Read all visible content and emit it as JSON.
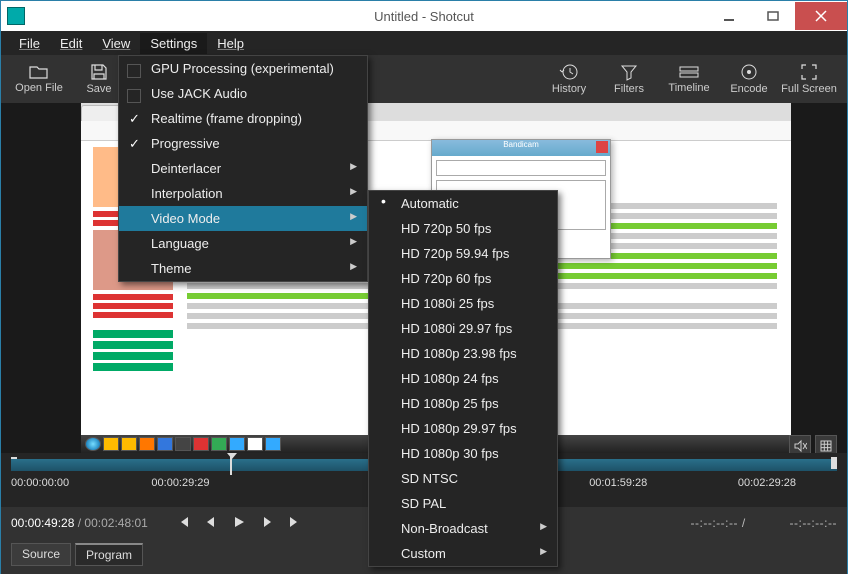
{
  "titlebar": {
    "title": "Untitled - Shotcut"
  },
  "menubar": {
    "file": "File",
    "edit": "Edit",
    "view": "View",
    "settings": "Settings",
    "help": "Help"
  },
  "toolbar": {
    "openfile": "Open File",
    "save": "Save",
    "history": "History",
    "filters": "Filters",
    "timeline": "Timeline",
    "encode": "Encode",
    "fullscreen": "Full Screen"
  },
  "settings_menu": {
    "gpu": "GPU Processing (experimental)",
    "jack": "Use JACK Audio",
    "realtime": "Realtime (frame dropping)",
    "progressive": "Progressive",
    "deinterlacer": "Deinterlacer",
    "interpolation": "Interpolation",
    "video_mode": "Video Mode",
    "language": "Language",
    "theme": "Theme"
  },
  "video_mode_menu": {
    "automatic": "Automatic",
    "items": [
      "HD 720p 50 fps",
      "HD 720p 59.94 fps",
      "HD 720p 60 fps",
      "HD 1080i 25 fps",
      "HD 1080i 29.97 fps",
      "HD 1080p 23.98 fps",
      "HD 1080p 24 fps",
      "HD 1080p 25 fps",
      "HD 1080p 29.97 fps",
      "HD 1080p 30 fps",
      "SD NTSC",
      "SD PAL"
    ],
    "non_broadcast": "Non-Broadcast",
    "custom": "Custom"
  },
  "timeline": {
    "markers": [
      "00:00:00:00",
      "00:00:29:29",
      "00:01:59:28",
      "00:02:29:28"
    ],
    "current": "00:00:49:28",
    "total": "00:02:48:01",
    "dash": "--:--:--:--",
    "sep": " / "
  },
  "bottom_tabs": {
    "source": "Source",
    "program": "Program"
  },
  "colors": {
    "accent": "#1f7a9c"
  }
}
